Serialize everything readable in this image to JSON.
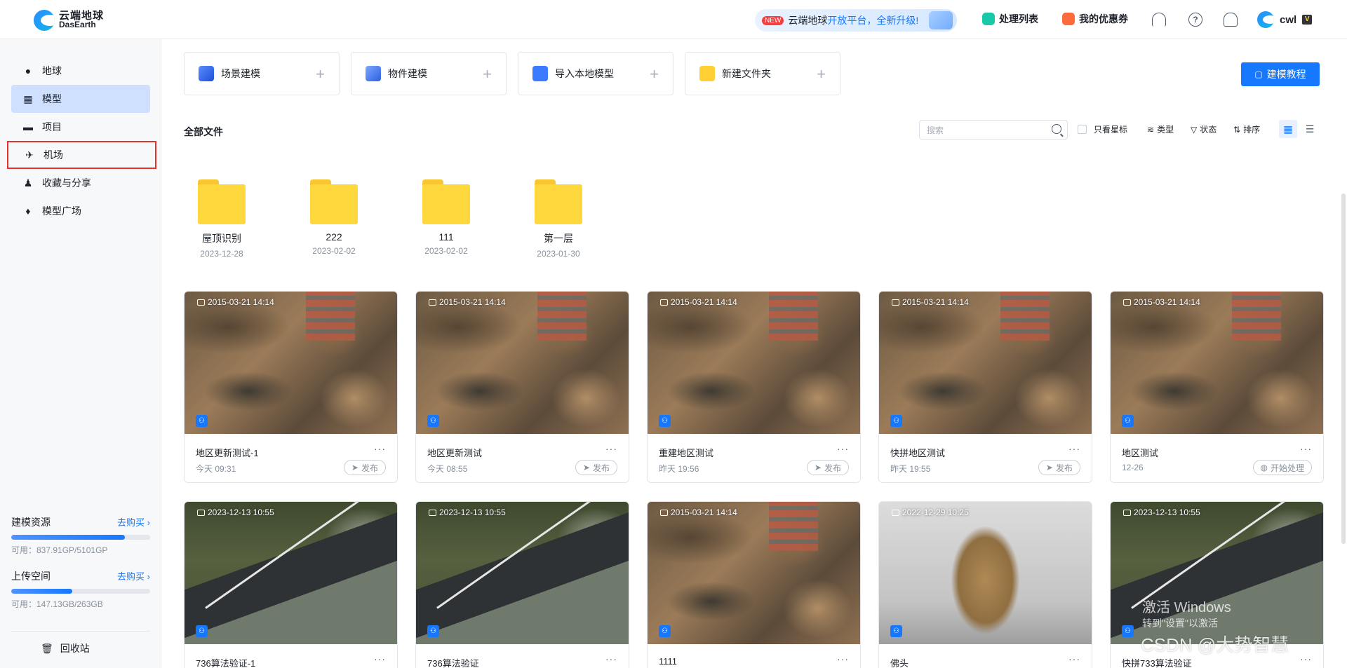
{
  "brand": {
    "name_cn": "云端地球",
    "name_en": "DasEarth"
  },
  "header": {
    "promo_badge": "NEW",
    "promo_text": "云端地球",
    "promo_highlight": "开放平台，全新升级!",
    "process_list": "处理列表",
    "coupons": "我的优惠券",
    "help_icon": "?",
    "username": "cwl"
  },
  "sidebar": {
    "items": [
      {
        "label": "地球",
        "icon": "globe-icon"
      },
      {
        "label": "模型",
        "icon": "grid-icon"
      },
      {
        "label": "项目",
        "icon": "folder-icon"
      },
      {
        "label": "机场",
        "icon": "drone-icon"
      },
      {
        "label": "收藏与分享",
        "icon": "user-share-icon"
      },
      {
        "label": "模型广场",
        "icon": "fire-icon"
      }
    ],
    "active_index": 1,
    "resources": [
      {
        "title": "建模资源",
        "buy": "去购买 ›",
        "usage": 0.82,
        "avail": "可用：837.91GP/5101GP"
      },
      {
        "title": "上传空间",
        "buy": "去购买 ›",
        "usage": 0.44,
        "avail": "可用：147.13GB/263GB"
      }
    ],
    "recycle": "回收站"
  },
  "actions": [
    {
      "label": "场景建模"
    },
    {
      "label": "物件建模"
    },
    {
      "label": "导入本地模型"
    },
    {
      "label": "新建文件夹"
    }
  ],
  "tutorial_button": "建模教程",
  "section_title": "全部文件",
  "search": {
    "placeholder": "搜索"
  },
  "filters": {
    "starred": "只看星标",
    "type": "类型",
    "status": "状态",
    "sort": "排序"
  },
  "folders": [
    {
      "name": "屋顶识别",
      "date": "2023-12-28"
    },
    {
      "name": "222",
      "date": "2023-02-02"
    },
    {
      "name": "111",
      "date": "2023-02-02"
    },
    {
      "name": "第一层",
      "date": "2023-01-30"
    }
  ],
  "cards": [
    {
      "ts": "2015-03-21 14:14",
      "name": "地区更新测试-1",
      "time": "今天 09:31",
      "action": "发布"
    },
    {
      "ts": "2015-03-21 14:14",
      "name": "地区更新测试",
      "time": "今天 08:55",
      "action": "发布"
    },
    {
      "ts": "2015-03-21 14:14",
      "name": "重建地区测试",
      "time": "昨天 19:56",
      "action": "发布"
    },
    {
      "ts": "2015-03-21 14:14",
      "name": "快拼地区测试",
      "time": "昨天 19:55",
      "action": "发布"
    },
    {
      "ts": "2015-03-21 14:14",
      "name": "地区测试",
      "time": "12-26",
      "action": "开始处理"
    },
    {
      "ts": "2023-12-13 10:55",
      "name": "736算法验证-1"
    },
    {
      "ts": "2023-12-13 10:55",
      "name": "736算法验证"
    },
    {
      "ts": "2015-03-21 14:14",
      "name": "1111"
    },
    {
      "ts": "2022-12-29 10:25",
      "name": "佛头"
    },
    {
      "ts": "2023-12-13 10:55",
      "name": "快拼733算法验证"
    }
  ],
  "overlay": {
    "windows": "激活 Windows",
    "windows_sub": "转到\"设置\"以激活",
    "csdn": "CSDN @大势智慧"
  },
  "colors": {
    "accent": "#1677ff",
    "highlight_border": "#e8312f"
  }
}
